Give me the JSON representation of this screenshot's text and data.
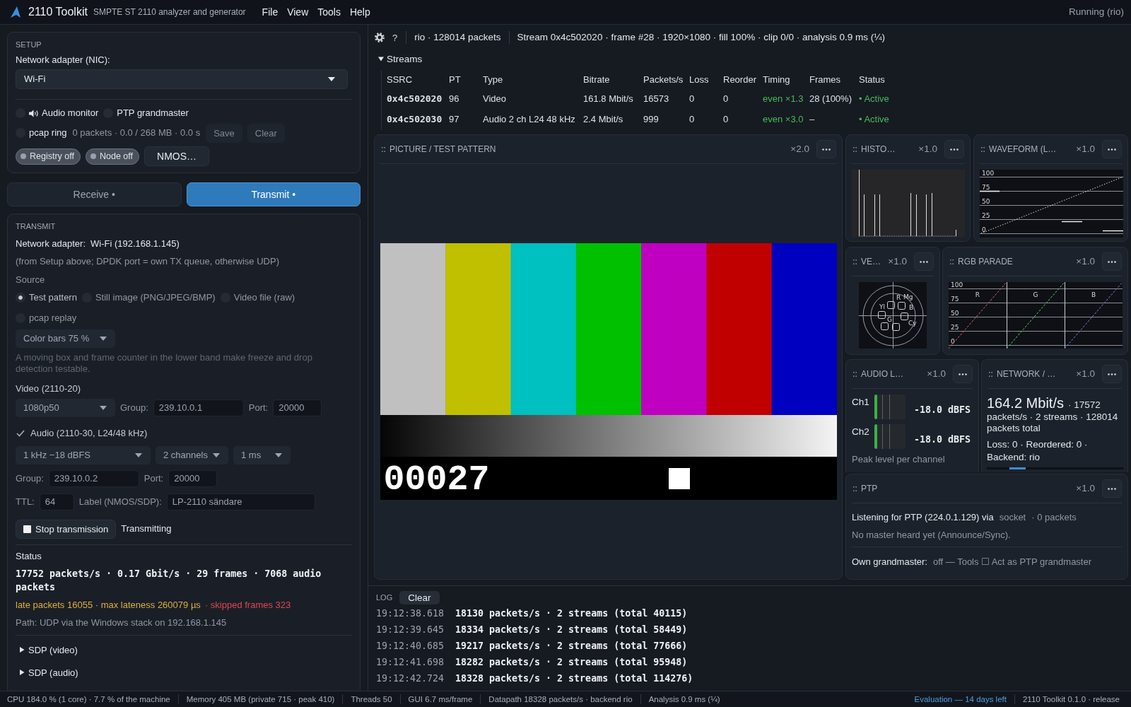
{
  "app_bar": {
    "title": "2110 Toolkit",
    "subtitle": "SMPTE ST 2110 analyzer and generator",
    "menus": [
      "File",
      "View",
      "Tools",
      "Help"
    ],
    "run_state": "Running (rio)"
  },
  "setup": {
    "heading": "SETUP",
    "nic_label": "Network adapter (NIC):",
    "nic_value": "Wi-Fi",
    "toggles": [
      {
        "kind": "audio",
        "label": "Audio monitor",
        "checked": false
      },
      {
        "kind": "plain",
        "label": "PTP grandmaster",
        "checked": false
      }
    ],
    "pcap": {
      "label": "pcap ring",
      "checked": false,
      "info": "0 packets · 0.0 / 268 MB · 0.0 s",
      "buttons": [
        {
          "label": "Save",
          "disabled": true
        },
        {
          "label": "Clear",
          "disabled": true
        }
      ]
    },
    "services": [
      {
        "label": "Registry off",
        "on": false
      },
      {
        "label": "Node off",
        "on": false
      }
    ],
    "nmos_button": "NMOS…"
  },
  "mode_tabs": [
    {
      "label": "Receive •",
      "selected": false
    },
    {
      "label": "Transmit •",
      "selected": true
    }
  ],
  "transmit": {
    "heading": "TRANSMIT",
    "adapter_label": "Network adapter:",
    "adapter_value": "Wi-Fi (192.168.1.145)",
    "adapter_note": "(from Setup above; DPDK port = own TX queue, otherwise UDP)",
    "source_label": "Source",
    "sources": [
      {
        "label": "Test pattern",
        "selected": true
      },
      {
        "label": "Still image (PNG/JPEG/BMP)",
        "selected": false
      },
      {
        "label": "Video file (raw)",
        "selected": false
      },
      {
        "label": "pcap replay",
        "selected": false
      }
    ],
    "pattern": "Color bars 75 %",
    "pattern_hint": "A moving box and frame counter in the lower band make freeze and drop detection testable.",
    "video": {
      "heading": "Video (2110-20)",
      "format": "1080p50",
      "group_label": "Group:",
      "group": "239.10.0.1",
      "port_label": "Port:",
      "port": "20000"
    },
    "audio": {
      "label": "Audio (2110-30, L24/48 kHz)",
      "checked": true,
      "tone": "1 kHz −18 dBFS",
      "channels": "2 channels",
      "packet_time": "1 ms",
      "group_label": "Group:",
      "group": "239.10.0.2",
      "port_label": "Port:",
      "port": "20000"
    },
    "ttl_label": "TTL:",
    "ttl": "64",
    "name_label": "Label (NMOS/SDP):",
    "name": "LP-2110 sändare",
    "stop_button": "Stop transmission",
    "state": "Transmitting",
    "status_heading": "Status",
    "status_line": "17752 packets/s · 0.17 Gbit/s · 29 frames · 7068 audio packets",
    "alerts": [
      {
        "text": "late packets 16055 · max lateness 260079 µs",
        "color": "#d9b13d"
      },
      {
        "text": "· skipped frames 323",
        "color": "#e0474d"
      }
    ],
    "path": "Path: UDP via the Windows stack on 192.168.1.145",
    "sections": [
      {
        "label": "SDP (video)",
        "expanded": false
      },
      {
        "label": "SDP (audio)",
        "expanded": false
      }
    ]
  },
  "toolbar": {
    "help": "?",
    "source_info": "rio · 128014 packets",
    "stream_info": "Stream 0x4c502020 · frame #28 · 1920×1080 · fill 100% · clip 0/0 · analysis 0.9 ms (¼)"
  },
  "streams": {
    "title": "Streams",
    "expanded": true,
    "columns": [
      "SSRC",
      "PT",
      "Type",
      "Bitrate",
      "Packets/s",
      "Loss",
      "Reorder",
      "Timing",
      "Frames",
      "Status"
    ],
    "rows": [
      {
        "cells": [
          "0x4c502020",
          "96",
          "Video",
          "161.8 Mbit/s",
          "16573",
          "0",
          "0",
          "even ×1.3",
          "28 (100%)",
          "• Active"
        ]
      },
      {
        "cells": [
          "0x4c502030",
          "97",
          "Audio 2 ch L24 48 kHz",
          "2.4 Mbit/s",
          "999",
          "0",
          "0",
          "even ×3.0",
          "–",
          "• Active"
        ]
      }
    ]
  },
  "panels": {
    "picture": {
      "title": "PICTURE / TEST PATTERN",
      "zoom": "×2.0",
      "frame_counter": "00027"
    },
    "histogram": {
      "title": "HISTO…",
      "zoom": "×1.0"
    },
    "waveform": {
      "title": "WAVEFORM (L…",
      "zoom": "×1.0",
      "scale": [
        "100",
        "75",
        "50",
        "25",
        "0"
      ]
    },
    "vectorscope": {
      "title": "VE…",
      "zoom": "×1.0",
      "targets": [
        "R",
        "Mg",
        "Yl",
        "B",
        "G",
        "Cy"
      ]
    },
    "rgb_parade": {
      "title": "RGB PARADE",
      "zoom": "×1.0",
      "scale": [
        "100",
        "75",
        "50",
        "25",
        "0"
      ],
      "channels": [
        "R",
        "G",
        "B"
      ]
    },
    "audio_levels": {
      "title": "AUDIO L…",
      "zoom": "×1.0",
      "channels": [
        {
          "name": "Ch1",
          "level": 0.1,
          "reading": "-18.0 dBFS"
        },
        {
          "name": "Ch2",
          "level": 0.1,
          "reading": "-18.0 dBFS"
        }
      ],
      "note": "Peak level per channel"
    },
    "network": {
      "title": "NETWORK / …",
      "zoom": "×1.0",
      "rate": "164.2 Mbit/s",
      "summary": "· 17572 packets/s · 2 streams · 128014 packets total",
      "errors": "Loss: 0 · Reordered: 0 ·",
      "backend": "Backend: rio"
    },
    "ptp": {
      "title": "PTP",
      "zoom": "×1.0",
      "listening": "Listening for PTP (224.0.1.129) via",
      "transport": "socket",
      "packets": "· 0 packets",
      "master": "No master heard yet (Announce/Sync).",
      "grandmaster_label": "Own grandmaster:",
      "grandmaster_value": "off — Tools ☐ Act as PTP grandmaster"
    }
  },
  "log": {
    "heading": "LOG",
    "clear_button": "Clear",
    "entries": [
      {
        "time": "19:12:38.618",
        "message": "18130 packets/s · 2 streams (total 40115)"
      },
      {
        "time": "19:12:39.645",
        "message": "18334 packets/s · 2 streams (total 58449)"
      },
      {
        "time": "19:12:40.685",
        "message": "19217 packets/s · 2 streams (total 77666)"
      },
      {
        "time": "19:12:41.698",
        "message": "18282 packets/s · 2 streams (total 95948)"
      },
      {
        "time": "19:12:42.724",
        "message": "18328 packets/s · 2 streams (total 114276)"
      }
    ]
  },
  "status_bar": {
    "items": [
      "CPU 184.0 % (1 core) · 7.7 % of the machine",
      "Memory 405 MB (private 715 · peak 410)",
      "Threads 50",
      "GUI 6.7 ms/frame",
      "Datapath 18328 packets/s · backend rio",
      "Analysis 0.9 ms (¼)"
    ],
    "evaluation": "Evaluation — 14 days left",
    "version": "2110 Toolkit 0.1.0 · release"
  }
}
